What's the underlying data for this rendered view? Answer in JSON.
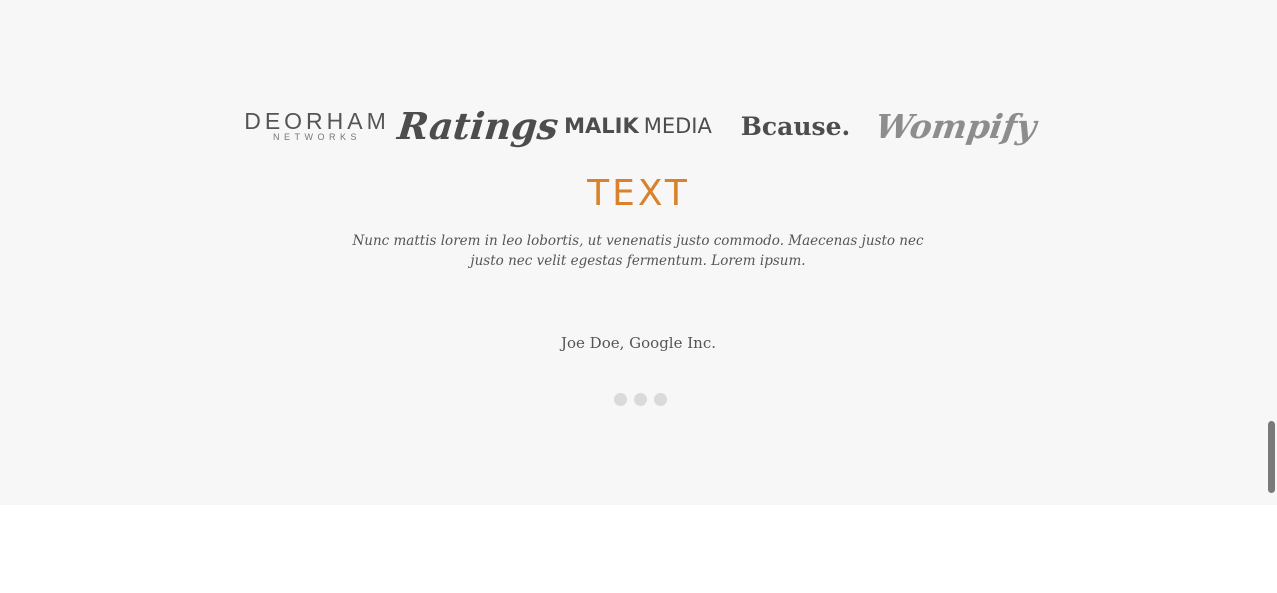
{
  "logos": [
    {
      "name": "DEORHAM",
      "sub": "NETWORKS"
    },
    {
      "name": "Ratings"
    },
    {
      "name_bold": "MALIK",
      "name_light": "MEDIA"
    },
    {
      "name": "Bcause."
    },
    {
      "name": "Wompify"
    }
  ],
  "testimonial": {
    "title": "TEXT",
    "quote": "Nunc mattis lorem in leo lobortis, ut venenatis justo commodo. Maecenas justo nec justo nec velit egestas fermentum. Lorem ipsum.",
    "author": "Joe Doe, Google Inc."
  },
  "pagination": {
    "count": 3
  },
  "colors": {
    "accent": "#d9822b",
    "section_bg": "#f7f7f7",
    "text": "#555555",
    "dot": "#dadada"
  }
}
